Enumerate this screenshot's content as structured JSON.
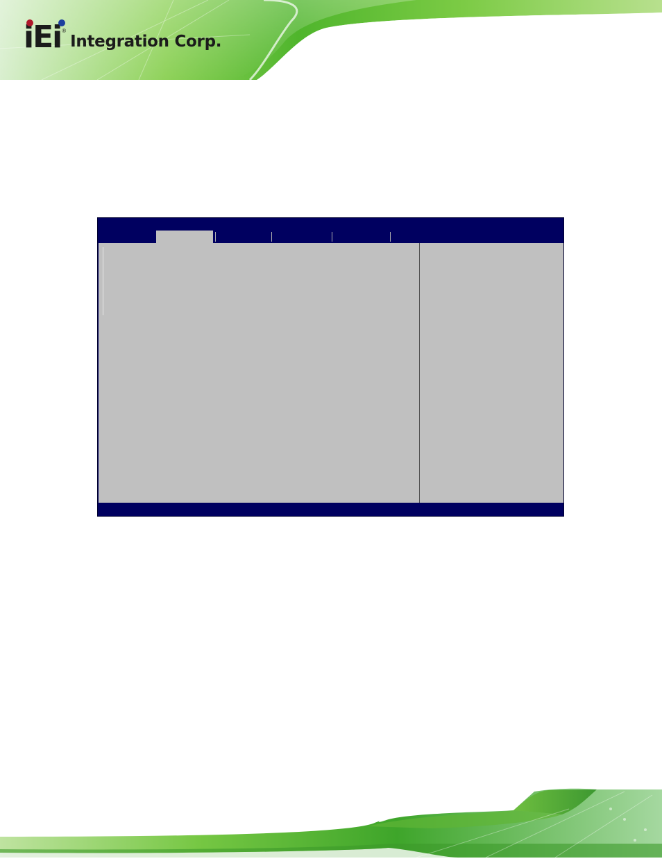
{
  "header": {
    "logo_mark": "iEi",
    "logo_text": "Integration Corp.",
    "registered": "®"
  },
  "bios": {
    "title": "",
    "tabs": [
      "",
      "",
      "",
      "",
      "",
      ""
    ],
    "footer": ""
  },
  "colors": {
    "bios_background": "#000060",
    "bios_panel": "#c0c0c0",
    "banner_green": "#6cc436",
    "banner_dark_green": "#2f8f22"
  }
}
